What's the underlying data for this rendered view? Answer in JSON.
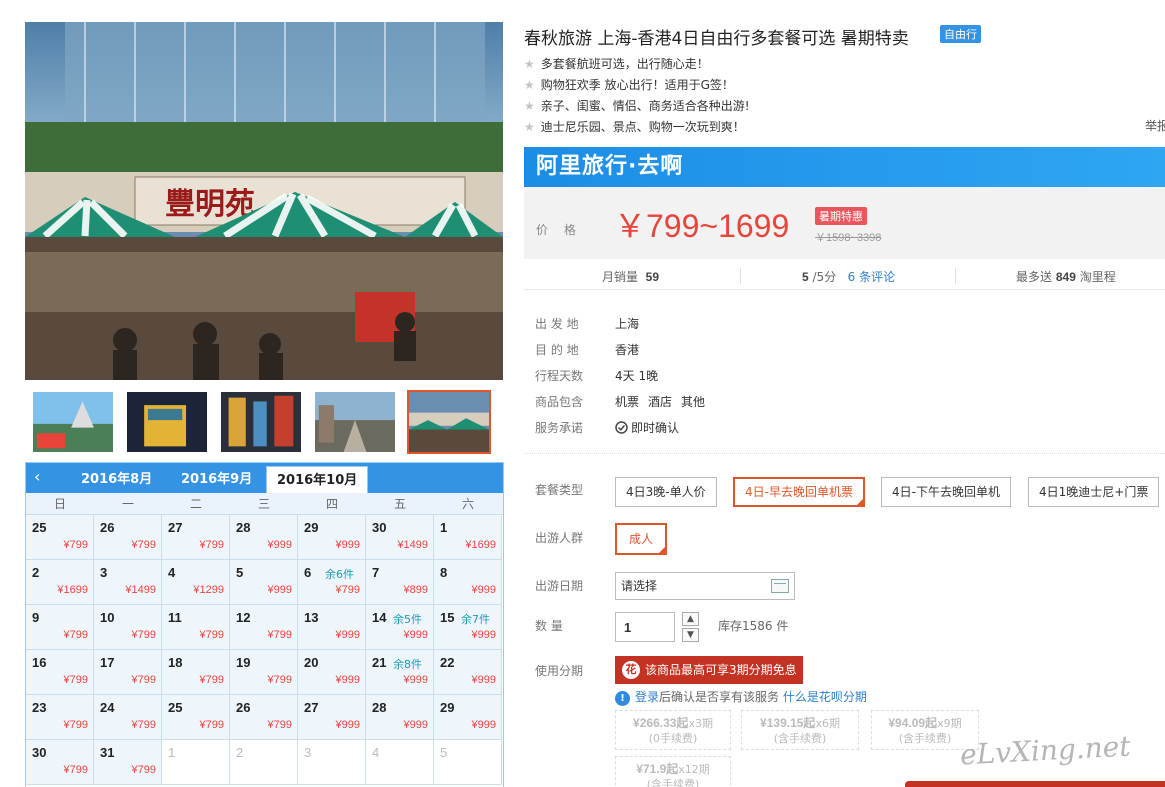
{
  "product": {
    "title": "春秋旅游 上海-香港4日自由行多套餐可选 暑期特卖",
    "tag": "自由行",
    "features": [
      "多套餐航班可选，出行随心走！",
      "购物狂欢季 放心出行！适用于G签！",
      "亲子、闺蜜、情侣、商务适合各种出游!",
      "迪士尼乐园、景点、购物一次玩到爽！"
    ],
    "report_link": "举报"
  },
  "price_box": {
    "brand": "阿里旅行·去啊",
    "label": "价 格",
    "price": "￥799~1699",
    "badge": "暑期特惠",
    "original": "￥1598~3398"
  },
  "stats": {
    "sales_label": "月销量",
    "sales_value": "59",
    "rating_value": "5",
    "rating_max": "/5分",
    "reviews": "6 条评论",
    "points_prefix": "最多送",
    "points_value": "849",
    "points_suffix": "淘里程"
  },
  "details": [
    {
      "label": "出 发 地",
      "value": "上海"
    },
    {
      "label": "目 的 地",
      "value": "香港"
    },
    {
      "label": "行程天数",
      "value": "4天 1晚"
    }
  ],
  "includes": {
    "label": "商品包含",
    "items": [
      "机票",
      "酒店",
      "其他"
    ]
  },
  "promise": {
    "label": "服务承诺",
    "value": "即时确认"
  },
  "package": {
    "label": "套餐类型",
    "options": [
      "4日3晚-单人价",
      "4日-早去晚回单机票",
      "4日-下午去晚回单机",
      "4日1晚迪士尼+门票"
    ],
    "selected_index": 1
  },
  "crowd": {
    "label": "出游人群",
    "value": "成人"
  },
  "travel_date": {
    "label": "出游日期",
    "placeholder": "请选择"
  },
  "quantity": {
    "label": "数 量",
    "value": "1",
    "stock": "库存1586 件"
  },
  "installment": {
    "label": "使用分期",
    "button": "该商品最高可享3期分期免息",
    "icon": "花",
    "tip_login": "登录",
    "tip_text": "后确认是否享有该服务",
    "tip_link": "什么是花呗分期",
    "plans": [
      {
        "amount": "¥266.33起",
        "term": "x3期",
        "fee": "(0手续费)"
      },
      {
        "amount": "¥139.15起",
        "term": "x6期",
        "fee": "(含手续费)"
      },
      {
        "amount": "¥94.09起",
        "term": "x9期",
        "fee": "(含手续费)"
      },
      {
        "amount": "¥71.9起",
        "term": "x12期",
        "fee": "(含手续费)"
      }
    ]
  },
  "calendar": {
    "tabs": [
      "2016年8月",
      "2016年9月",
      "2016年10月"
    ],
    "active_tab": 2,
    "weekdays": [
      "日",
      "一",
      "二",
      "三",
      "四",
      "五",
      "六"
    ],
    "days": [
      {
        "d": "25",
        "p": "¥799"
      },
      {
        "d": "26",
        "p": "¥799"
      },
      {
        "d": "27",
        "p": "¥799"
      },
      {
        "d": "28",
        "p": "¥999"
      },
      {
        "d": "29",
        "p": "¥999"
      },
      {
        "d": "30",
        "p": "¥1499"
      },
      {
        "d": "1",
        "p": "¥1699"
      },
      {
        "d": "2",
        "p": "¥1699"
      },
      {
        "d": "3",
        "p": "¥1499"
      },
      {
        "d": "4",
        "p": "¥1299"
      },
      {
        "d": "5",
        "p": "¥999"
      },
      {
        "d": "6",
        "p": "¥799",
        "s": "余6件"
      },
      {
        "d": "7",
        "p": "¥899"
      },
      {
        "d": "8",
        "p": "¥999"
      },
      {
        "d": "9",
        "p": "¥799"
      },
      {
        "d": "10",
        "p": "¥799"
      },
      {
        "d": "11",
        "p": "¥799"
      },
      {
        "d": "12",
        "p": "¥799"
      },
      {
        "d": "13",
        "p": "¥999"
      },
      {
        "d": "14",
        "p": "¥999",
        "s": "余5件"
      },
      {
        "d": "15",
        "p": "¥999",
        "s": "余7件"
      },
      {
        "d": "16",
        "p": "¥799"
      },
      {
        "d": "17",
        "p": "¥799"
      },
      {
        "d": "18",
        "p": "¥799"
      },
      {
        "d": "19",
        "p": "¥799"
      },
      {
        "d": "20",
        "p": "¥999"
      },
      {
        "d": "21",
        "p": "¥999",
        "s": "余8件"
      },
      {
        "d": "22",
        "p": "¥999"
      },
      {
        "d": "23",
        "p": "¥799"
      },
      {
        "d": "24",
        "p": "¥799"
      },
      {
        "d": "25",
        "p": "¥799"
      },
      {
        "d": "26",
        "p": "¥799"
      },
      {
        "d": "27",
        "p": "¥999"
      },
      {
        "d": "28",
        "p": "¥999"
      },
      {
        "d": "29",
        "p": "¥999"
      },
      {
        "d": "30",
        "p": "¥799"
      },
      {
        "d": "31",
        "p": "¥799"
      },
      {
        "d": "1",
        "other": true
      },
      {
        "d": "2",
        "other": true
      },
      {
        "d": "3",
        "other": true
      },
      {
        "d": "4",
        "other": true
      },
      {
        "d": "5",
        "other": true
      }
    ]
  },
  "photo_sign": "豐明苑",
  "watermark": "eLvXing.net",
  "colors": {
    "accent": "#3593e6",
    "price": "#e8443a",
    "selected": "#e0562a",
    "installment": "#c33222"
  }
}
